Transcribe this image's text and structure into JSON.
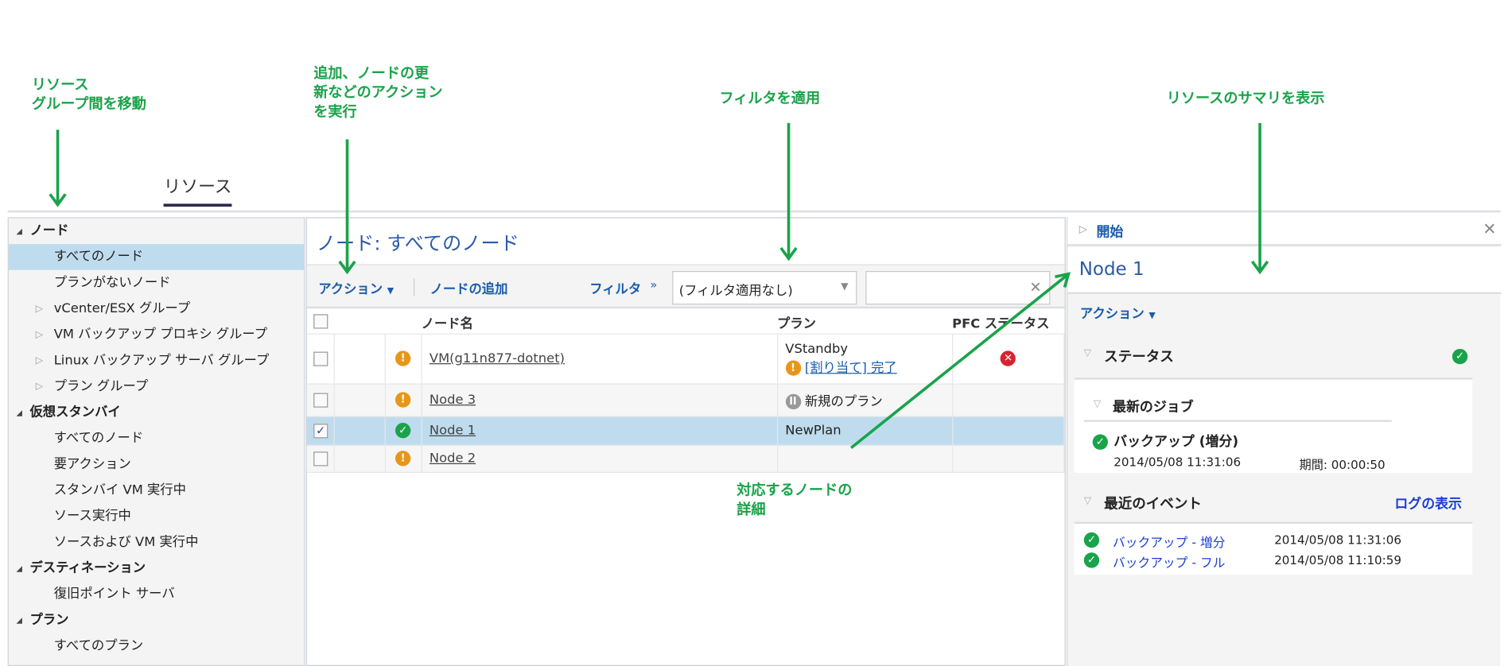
{
  "annotations": {
    "nav": "リソース\nグループ間を移動",
    "actions": "追加、ノードの更\n新などのアクション\nを実行",
    "filter": "フィルタを適用",
    "summary": "リソースのサマリを表示",
    "details": "対応するノードの\n詳細"
  },
  "tab": "リソース",
  "sidebar": [
    {
      "label": "ノード",
      "type": "header"
    },
    {
      "label": "すべてのノード",
      "type": "item",
      "selected": true
    },
    {
      "label": "プランがないノード",
      "type": "item"
    },
    {
      "label": "vCenter/ESX グループ",
      "type": "group"
    },
    {
      "label": "VM バックアップ プロキシ グループ",
      "type": "group"
    },
    {
      "label": "Linux バックアップ サーバ グループ",
      "type": "group"
    },
    {
      "label": "プラン グループ",
      "type": "group"
    },
    {
      "label": "仮想スタンバイ",
      "type": "header"
    },
    {
      "label": "すべてのノード",
      "type": "item"
    },
    {
      "label": "要アクション",
      "type": "item"
    },
    {
      "label": "スタンバイ VM 実行中",
      "type": "item"
    },
    {
      "label": "ソース実行中",
      "type": "item"
    },
    {
      "label": "ソースおよび VM 実行中",
      "type": "item"
    },
    {
      "label": "デスティネーション",
      "type": "header"
    },
    {
      "label": "復旧ポイント サーバ",
      "type": "item"
    },
    {
      "label": "プラン",
      "type": "header"
    },
    {
      "label": "すべてのプラン",
      "type": "item"
    }
  ],
  "center": {
    "title": "ノード:  すべてのノード",
    "actions": "アクション",
    "add_node": "ノードの追加",
    "filter": "フィルタ",
    "filter_value": "(フィルタ適用なし)",
    "search_value": "",
    "columns": [
      "ノード名",
      "プラン",
      "PFC ステータス"
    ],
    "rows": [
      {
        "name": "VM(g11n877-dotnet)",
        "status": "warning",
        "plan": "VStandby",
        "plan_note": "[割り当て] 完了",
        "pfc": "error",
        "checked": false
      },
      {
        "name": "Node 3",
        "status": "warning",
        "plan": "新規のプラン",
        "plan_icon": "paused",
        "pfc": "",
        "checked": false
      },
      {
        "name": "Node 1",
        "status": "ok",
        "plan": "NewPlan",
        "pfc": "",
        "checked": true
      },
      {
        "name": "Node 2",
        "status": "warning",
        "plan": "",
        "pfc": "",
        "checked": false
      }
    ]
  },
  "right": {
    "start": "開始",
    "node_title": "Node 1",
    "actions": "アクション",
    "status": "ステータス",
    "latest_job": "最新のジョブ",
    "job_name": "バックアップ (増分)",
    "job_time": "2014/05/08 11:31:06",
    "job_duration": "期間: 00:00:50",
    "recent_events": "最近のイベント",
    "view_log": "ログの表示",
    "events": [
      {
        "name": "バックアップ - 増分",
        "time": "2014/05/08 11:31:06"
      },
      {
        "name": "バックアップ - フル",
        "time": "2014/05/08 11:10:59"
      }
    ]
  }
}
